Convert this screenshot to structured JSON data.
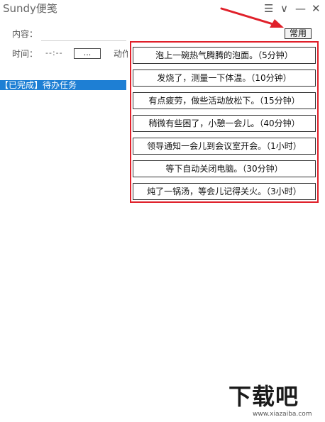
{
  "window": {
    "title": "Sundy便笺",
    "menu_glyph": "☰",
    "collapse_glyph": "∨",
    "minimize_glyph": "—",
    "close_glyph": "✕"
  },
  "form": {
    "content_label": "内容：",
    "time_label": "时间：",
    "time_value": "--:--",
    "time_button": "...",
    "action_label": "动作"
  },
  "common_button": "常用",
  "tasks": [
    "【已完成】待办任务"
  ],
  "presets": [
    "泡上一碗热气腾腾的泡面。（5分钟）",
    "发烧了，测量一下体温。（10分钟）",
    "有点疲劳，做些活动放松下。（15分钟）",
    "稍微有些困了，小憩一会儿。（40分钟）",
    "领导通知一会儿到会议室开会。（1小时）",
    "等下自动关闭电脑。（30分钟）",
    "炖了一锅汤，等会儿记得关火。（3小时）"
  ],
  "watermark": {
    "text": "下载吧",
    "url": "www.xiazaiba.com"
  },
  "colors": {
    "highlight_border": "#e0202a",
    "selected_row": "#1e7fd4"
  }
}
